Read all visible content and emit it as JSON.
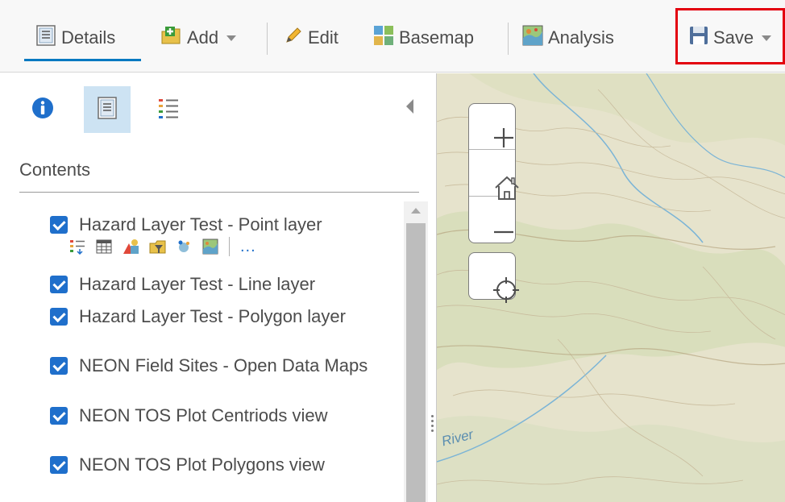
{
  "toolbar": {
    "details_label": "Details",
    "add_label": "Add",
    "edit_label": "Edit",
    "basemap_label": "Basemap",
    "analysis_label": "Analysis",
    "save_label": "Save"
  },
  "panel": {
    "tabs": [
      {
        "name": "about",
        "icon": "info-icon"
      },
      {
        "name": "content",
        "icon": "content-icon",
        "active": true
      },
      {
        "name": "legend",
        "icon": "legend-icon"
      }
    ],
    "contents_title": "Contents",
    "layers": [
      {
        "name": "Hazard Layer Test - Point layer",
        "checked": true
      },
      {
        "name": "Hazard Layer Test - Line layer",
        "checked": true
      },
      {
        "name": "Hazard Layer Test - Polygon layer",
        "checked": true
      },
      {
        "name": "NEON Field Sites - Open Data Maps",
        "checked": true
      },
      {
        "name": "NEON TOS Plot Centriods view",
        "checked": true
      },
      {
        "name": "NEON TOS Plot Polygons view",
        "checked": true
      }
    ],
    "layer_action_icons": [
      "show-legend-icon",
      "table-icon",
      "change-style-icon",
      "filter-icon",
      "perform-analysis-icon",
      "more-options-icon"
    ],
    "more_label": "..."
  },
  "map": {
    "river_label": "River",
    "controls": [
      "zoom-in",
      "home",
      "zoom-out",
      "locate"
    ]
  },
  "colors": {
    "accent": "#0079c1",
    "checkbox": "#1f6fcb",
    "highlight": "#e3000f",
    "map_base": "#e7e4cf"
  }
}
